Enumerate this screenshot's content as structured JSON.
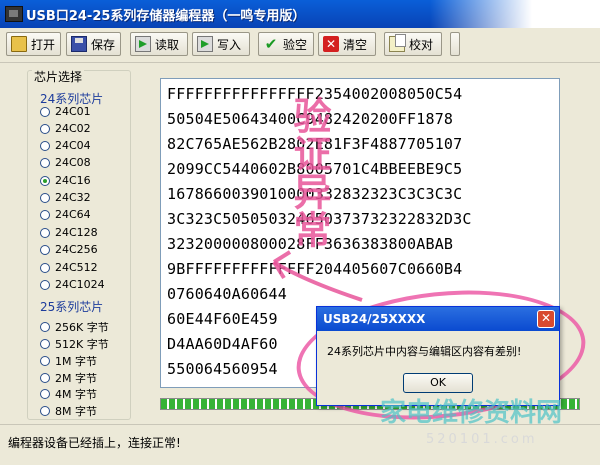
{
  "window": {
    "title": "USB口24-25系列存储器编程器（一鸣专用版）"
  },
  "toolbar": {
    "buttons": [
      {
        "label": "打开",
        "icon": "folder-icon"
      },
      {
        "label": "保存",
        "icon": "disk-icon"
      },
      {
        "label": "读取",
        "icon": "read-icon"
      },
      {
        "label": "写入",
        "icon": "write-icon"
      },
      {
        "label": "验空",
        "icon": "check-icon"
      },
      {
        "label": "清空",
        "icon": "clear-icon"
      },
      {
        "label": "校对",
        "icon": "compare-icon"
      }
    ]
  },
  "chip_select": {
    "legend": "芯片选择",
    "series24": {
      "heading": "24系列芯片",
      "options": [
        "24C01",
        "24C02",
        "24C04",
        "24C08",
        "24C16",
        "24C32",
        "24C64",
        "24C128",
        "24C256",
        "24C512",
        "24C1024"
      ],
      "selected": "24C16"
    },
    "series25": {
      "heading": "25系列芯片",
      "options": [
        "256K 字节",
        "512K 字节",
        "1M 字节",
        "2M 字节",
        "4M 字节",
        "8M 字节"
      ]
    }
  },
  "hex_editor": {
    "lines": [
      "FFFFFFFFFFFFFFFF2354002008050C54",
      "50504E50643400C9482420200FF1878",
      "82C765AE562B2802E81F3F4887705107",
      "2099CC5440602B8005701C4BBEEBE9C5",
      "1678660039010000332832323C3C3C3C",
      "3C323C505050324650373732322832D3C",
      "323200000800028FF3636383800ABAB",
      "9BFFFFFFFFFFFFFF204405607C0660B4",
      "0760640A60644",
      "60E44F60E459",
      "D4AA60D4AF60",
      "550064560954"
    ]
  },
  "handwritten_overlay": {
    "text": "验证异常",
    "color": "#e8559a"
  },
  "progress": {
    "value": 1.0
  },
  "dialog": {
    "title": "USB24/25XXXX",
    "message": "24系列芯片中内容与编辑区内容有差别!",
    "ok_label": "OK"
  },
  "status": {
    "text": "编程器设备已经插上，连接正常!"
  },
  "watermark": {
    "text": "家电维修资料网",
    "url_text": "520101.com"
  }
}
